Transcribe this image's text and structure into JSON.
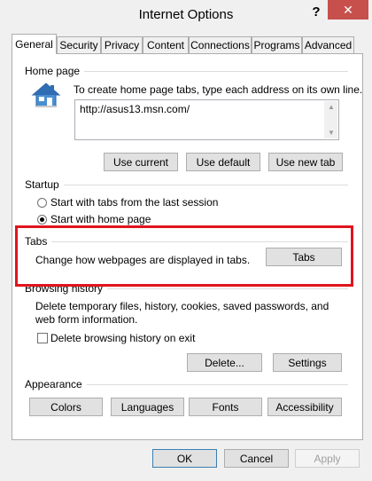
{
  "window": {
    "title": "Internet Options",
    "help_glyph": "?",
    "close_glyph": "✕"
  },
  "tabs": [
    "General",
    "Security",
    "Privacy",
    "Content",
    "Connections",
    "Programs",
    "Advanced"
  ],
  "home_page": {
    "label": "Home page",
    "description": "To create home page tabs, type each address on its own line.",
    "url": "http://asus13.msn.com/",
    "buttons": {
      "use_current": "Use current",
      "use_default": "Use default",
      "use_new_tab": "Use new tab"
    }
  },
  "startup": {
    "label": "Startup",
    "options": [
      "Start with tabs from the last session",
      "Start with home page"
    ],
    "selected": "Start with home page"
  },
  "tabs_section": {
    "label": "Tabs",
    "description": "Change how webpages are displayed in tabs.",
    "button": "Tabs"
  },
  "browsing_history": {
    "label": "Browsing history",
    "description": "Delete temporary files, history, cookies, saved passwords, and web form information.",
    "checkbox": "Delete browsing history on exit",
    "checkbox_checked": false,
    "buttons": {
      "delete": "Delete...",
      "settings": "Settings"
    }
  },
  "appearance": {
    "label": "Appearance",
    "buttons": {
      "colors": "Colors",
      "languages": "Languages",
      "fonts": "Fonts",
      "accessibility": "Accessibility"
    }
  },
  "footer": {
    "ok": "OK",
    "cancel": "Cancel",
    "apply": "Apply",
    "apply_enabled": false
  },
  "colors": {
    "highlight": "#e0141e",
    "close_button": "#c7504d"
  },
  "icons": {
    "home": "house-icon"
  }
}
